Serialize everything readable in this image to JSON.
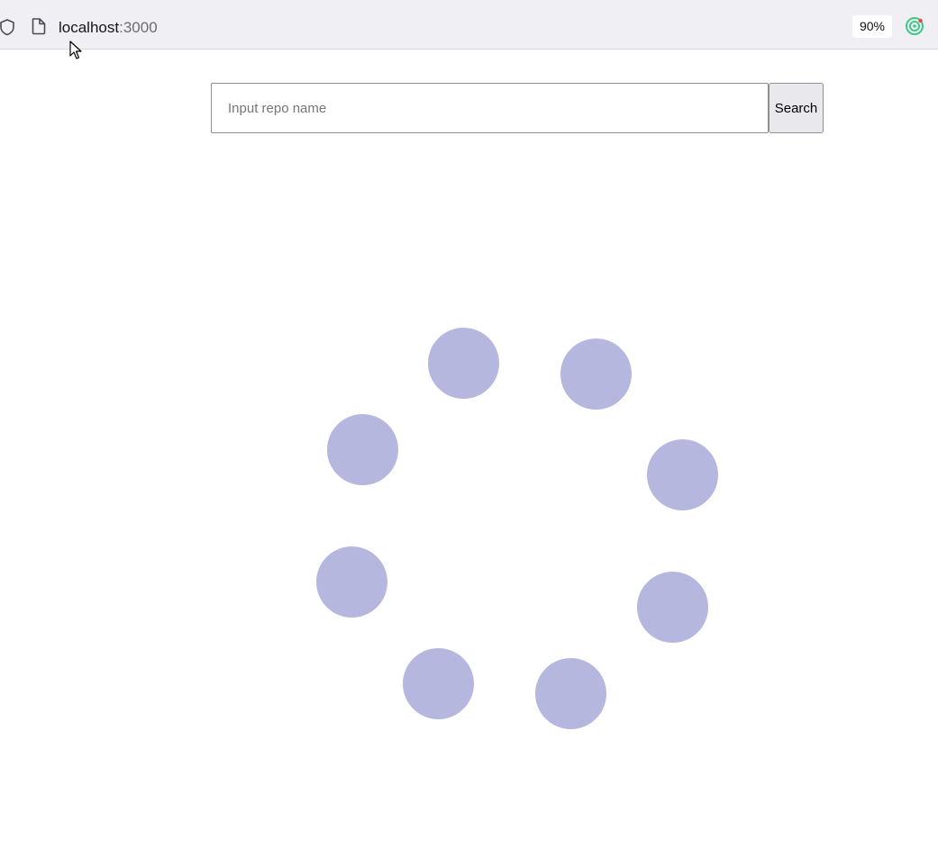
{
  "browser": {
    "url_host": "localhost",
    "url_port": ":3000",
    "zoom_level": "90%",
    "icons": {
      "tracking": "shield-icon",
      "page": "page-icon",
      "extension": "extension-icon",
      "overflow": "chevron-down-icon"
    }
  },
  "search": {
    "placeholder": "Input repo name",
    "value": "",
    "button_label": "Search"
  },
  "loader": {
    "dot_count": 8,
    "dot_color": "#b6b7df"
  }
}
